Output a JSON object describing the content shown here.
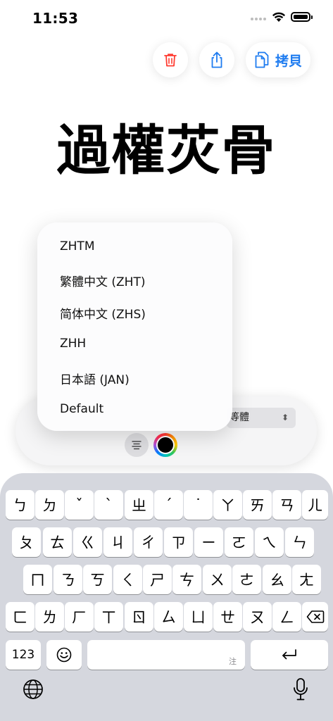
{
  "status_bar": {
    "time": "11:53"
  },
  "toolbar": {
    "delete_icon": "trash-icon",
    "share_icon": "share-icon",
    "copy_icon": "copy-icon",
    "copy_label": "拷貝",
    "accent_color": "#1f7cf0",
    "delete_color": "#ff3b30"
  },
  "main": {
    "title_text": "過權苂骨"
  },
  "language_menu": {
    "items": [
      "ZHTM",
      "繁體中文 (ZHT)",
      "简体中文 (ZHS)",
      "ZHH",
      "日本語 (JAN)",
      "Default"
    ]
  },
  "format_sheet": {
    "font_value": "等體",
    "align_icon": "align-center-icon",
    "color_icon": "color-wheel-icon",
    "selected_color": "#000000"
  },
  "keyboard": {
    "row1": [
      "ㄅ",
      "ㄉ",
      "ˇ",
      "ˋ",
      "ㄓ",
      "ˊ",
      "˙",
      "ㄚ",
      "ㄞ",
      "ㄢ",
      "ㄦ"
    ],
    "row2": [
      "ㄆ",
      "ㄊ",
      "ㄍ",
      "ㄐ",
      "ㄔ",
      "ㄗ",
      "ㄧ",
      "ㄛ",
      "ㄟ",
      "ㄣ"
    ],
    "row3": [
      "ㄇ",
      "ㄋ",
      "ㄎ",
      "ㄑ",
      "ㄕ",
      "ㄘ",
      "ㄨ",
      "ㄜ",
      "ㄠ",
      "ㄤ"
    ],
    "row4": [
      "ㄈ",
      "ㄌ",
      "ㄏ",
      "ㄒ",
      "ㄖ",
      "ㄙ",
      "ㄩ",
      "ㄝ",
      "ㄡ",
      "ㄥ"
    ],
    "numbers_label": "123",
    "space_hint": "注",
    "delete_icon": "delete-backward-icon",
    "emoji_icon": "emoji-icon",
    "return_icon": "return-icon",
    "globe_icon": "globe-icon",
    "mic_icon": "microphone-icon"
  }
}
